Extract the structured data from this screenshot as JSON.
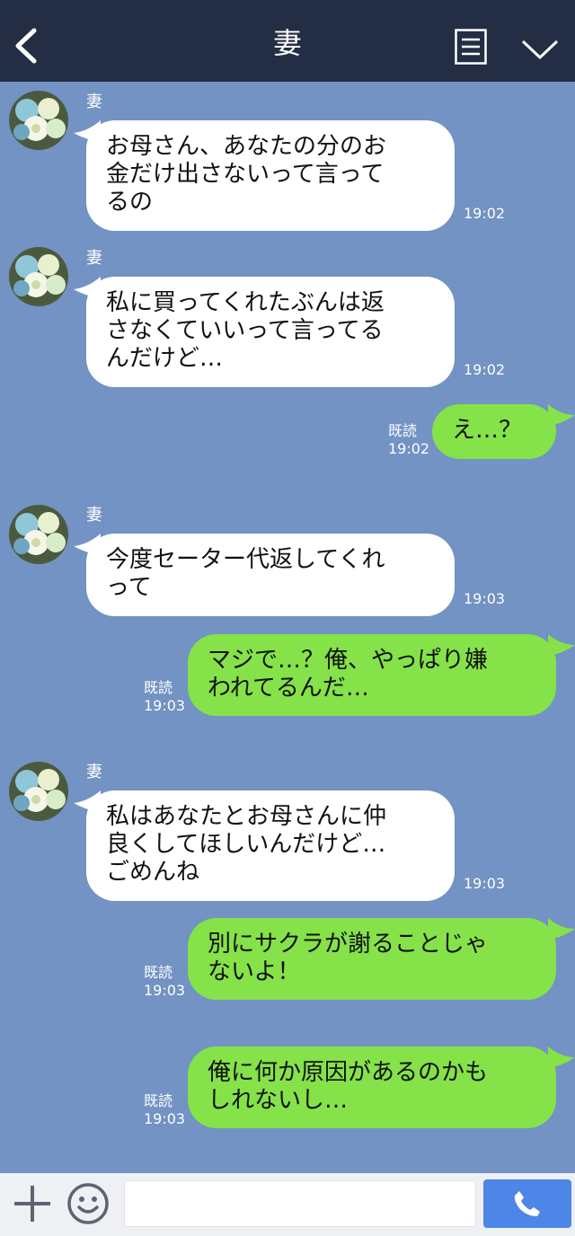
{
  "header": {
    "title": "妻",
    "icons": [
      "back-icon",
      "menu-icon",
      "chevron-down-icon"
    ]
  },
  "messages": [
    {
      "dir": "in",
      "sender": "妻",
      "lines": [
        "お母さん、あなたの分のお",
        "金だけ出さないって言って",
        "るの"
      ],
      "time": "19:02"
    },
    {
      "dir": "in",
      "sender": "妻",
      "lines": [
        "私に買ってくれたぶんは返",
        "さなくていいって言ってる",
        "んだけど…"
      ],
      "time": "19:02"
    },
    {
      "dir": "out",
      "lines": [
        "え…？"
      ],
      "read": "既読",
      "time": "19:02"
    },
    {
      "dir": "in",
      "sender": "妻",
      "lines": [
        "今度セーター代返してくれ",
        "って"
      ],
      "time": "19:03"
    },
    {
      "dir": "out",
      "lines": [
        "マジで…？俺、やっぱり嫌",
        "われてるんだ…"
      ],
      "read": "既読",
      "time": "19:03"
    },
    {
      "dir": "in",
      "sender": "妻",
      "lines": [
        "私はあなたとお母さんに仲",
        "良くしてほしいんだけど…",
        "ごめんね"
      ],
      "time": "19:03"
    },
    {
      "dir": "out",
      "lines": [
        "別にサクラが謝ることじゃ",
        "ないよ！"
      ],
      "read": "既読",
      "time": "19:03"
    },
    {
      "dir": "out",
      "lines": [
        "俺に何か原因があるのかも",
        "しれないし…"
      ],
      "read": "既読",
      "time": "19:03"
    }
  ],
  "inputbar": {
    "input_value": "",
    "icons": [
      "plus-icon",
      "emoji-icon",
      "phone-icon"
    ]
  },
  "colors": {
    "header_bg": "#232d44",
    "chat_bg": "#7293c3",
    "bubble_in": "#ffffff",
    "bubble_out": "#85e249",
    "call_button": "#4e86e8"
  }
}
